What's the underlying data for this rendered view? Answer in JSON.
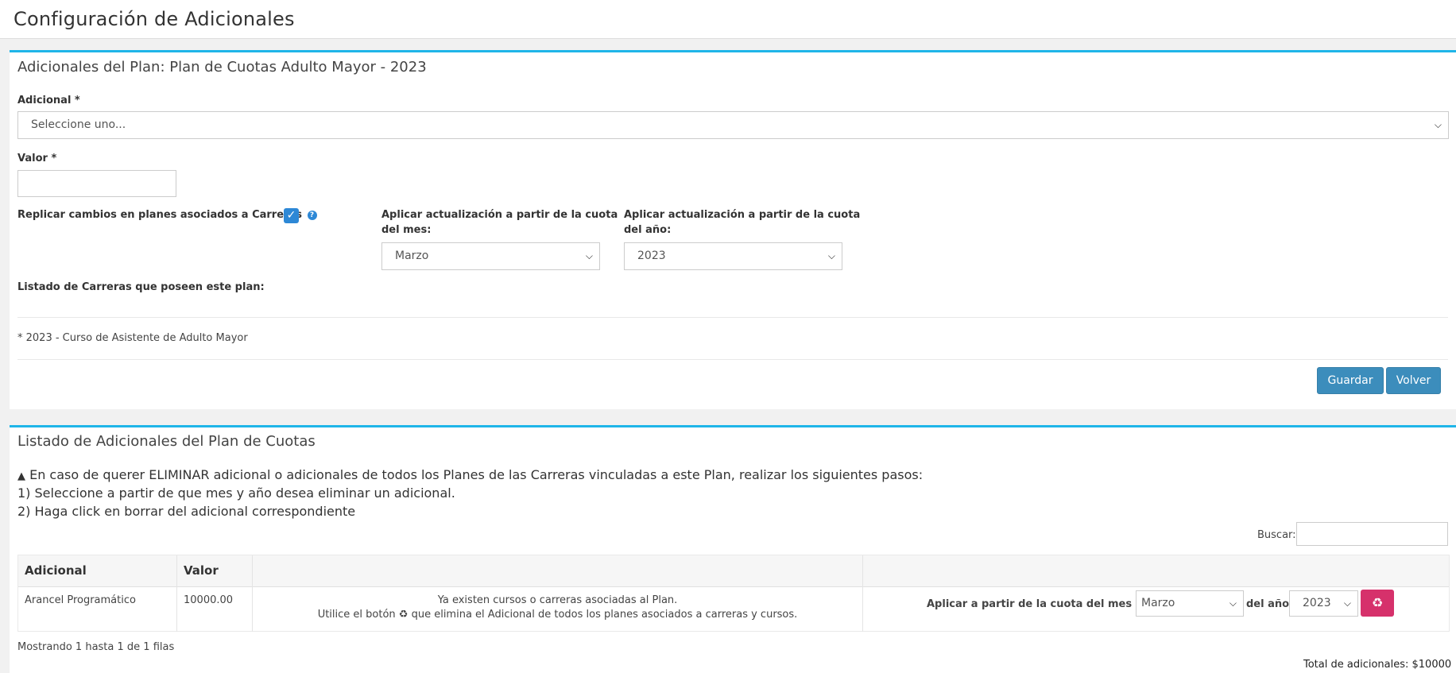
{
  "page": {
    "title": "Configuración de Adicionales"
  },
  "form": {
    "title": "Adicionales del Plan: Plan de Cuotas Adulto Mayor - 2023",
    "adicional_label": "Adicional *",
    "adicional_value": "Seleccione uno...",
    "valor_label": "Valor *",
    "valor_value": "",
    "replicar_label": "Replicar cambios en planes asociados a Carreras",
    "replicar_checked": true,
    "mes_label_1": "Aplicar actualización a partir de la cuota",
    "mes_label_2": "del mes:",
    "mes_value": "Marzo",
    "anio_label_1": "Aplicar actualización a partir de la cuota",
    "anio_label_2": "del año:",
    "anio_value": "2023",
    "carreras_label": "Listado de Carreras que poseen este plan:",
    "carreras": [
      "* 2023 - Curso de Asistente de Adulto Mayor"
    ],
    "guardar_label": "Guardar",
    "volver_label": "Volver"
  },
  "list": {
    "title": "Listado de Adicionales del Plan de Cuotas",
    "warning_line": "En caso de querer ELIMINAR adicional o adicionales de todos los Planes de las Carreras vinculadas a este Plan, realizar los siguientes pasos:",
    "step1": "1) Seleccione a partir de que mes y año desea eliminar un adicional.",
    "step2": "2) Haga click en borrar del adicional correspondiente",
    "search_label": "Buscar:",
    "search_value": "",
    "columns": [
      "Adicional",
      "Valor",
      "",
      ""
    ],
    "rows": [
      {
        "adicional": "Arancel Programático",
        "valor": "10000.00",
        "note_1": "Ya existen cursos o carreras asociadas al Plan.",
        "note_2_pre": "Utilice el botón",
        "note_2_post": "que elimina el Adicional de todos los planes asociados a carreras y cursos.",
        "apply_label": "Aplicar a partir de la cuota del mes de",
        "mes": "Marzo",
        "anio_label": "del año:",
        "anio": "2023"
      }
    ],
    "footer": "Mostrando 1 hasta 1 de 1 filas",
    "total": "Total de adicionales: $10000"
  },
  "colors": {
    "accent": "#1fb5e8",
    "primary": "#3c8dbc",
    "danger": "#d6316b"
  }
}
